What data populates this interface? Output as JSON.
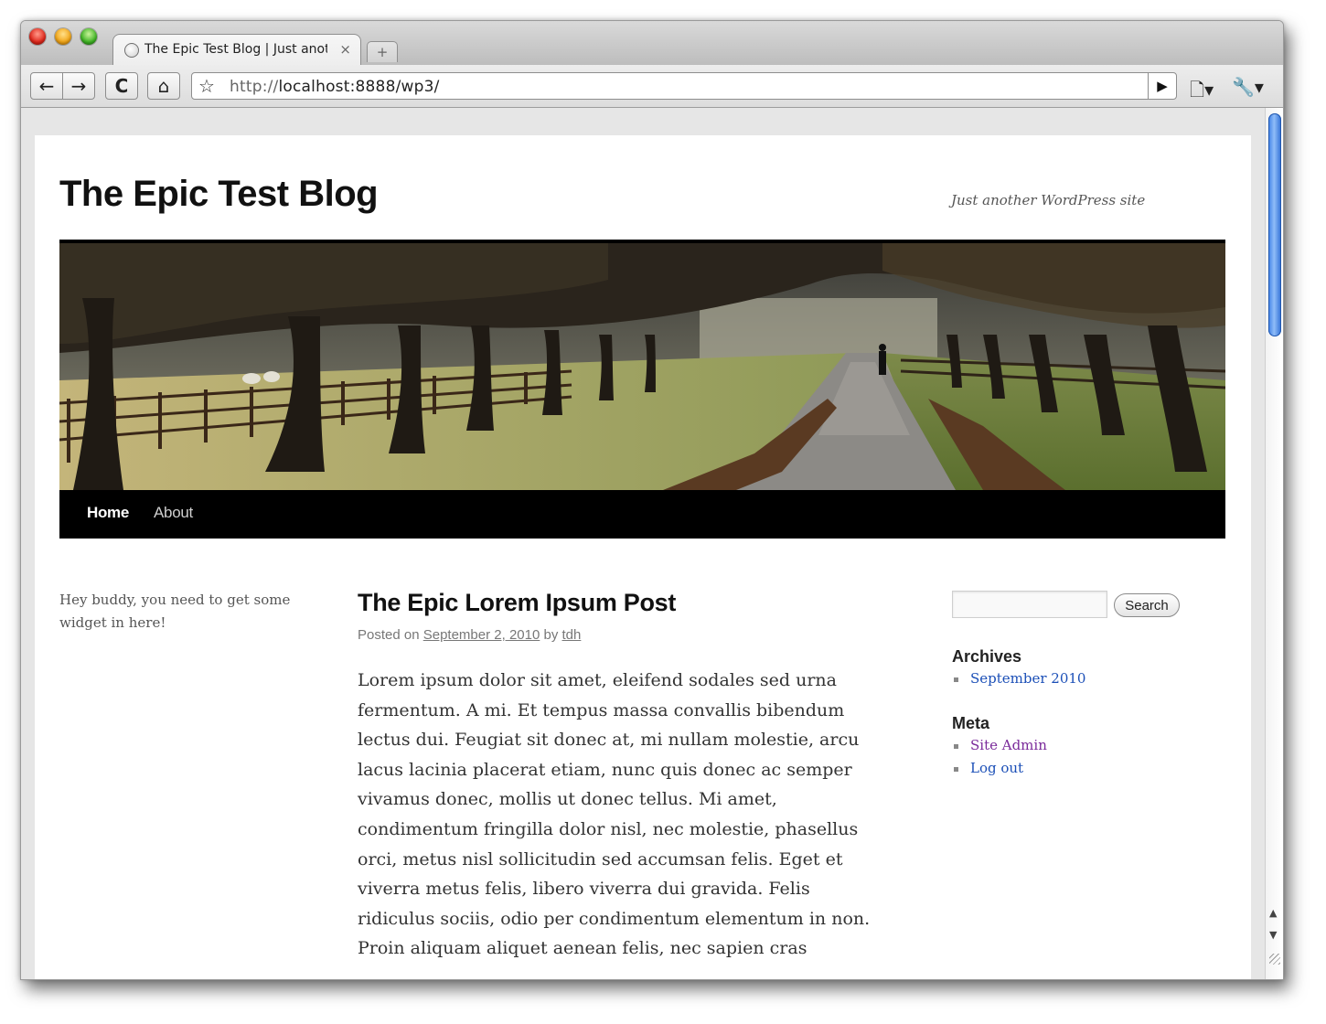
{
  "browser": {
    "tab_title": "The Epic Test Blog | Just another WordPress site",
    "tab_close": "×",
    "new_tab": "+",
    "url_scheme": "http://",
    "url_rest": "localhost:8888/wp3/",
    "back": "←",
    "forward": "→",
    "reload": "C",
    "home": "⌂",
    "bookmark": "☆",
    "go": "▶",
    "page_menu": "🗋▾",
    "tools_menu": "🔧▾"
  },
  "site": {
    "title": "The Epic Test Blog",
    "description": "Just another WordPress site",
    "nav": [
      {
        "label": "Home"
      },
      {
        "label": "About"
      }
    ]
  },
  "left_sidebar": {
    "text": "Hey buddy, you need to get some widget in here!"
  },
  "post": {
    "title": "The Epic Lorem Ipsum Post",
    "meta_prefix": "Posted on",
    "date": "September 2, 2010",
    "meta_by": "by",
    "author": "tdh",
    "body": "Lorem ipsum dolor sit amet, eleifend sodales sed urna fermentum. A mi. Et tempus massa convallis bibendum lectus dui. Feugiat sit donec at, mi nullam molestie, arcu lacus lacinia placerat etiam, nunc quis donec ac semper vivamus donec, mollis ut donec tellus. Mi amet, condimentum fringilla dolor nisl, nec molestie, phasellus orci, metus nisl sollicitudin sed accumsan felis. Eget et viverra metus felis, libero viverra dui gravida. Felis ridiculus sociis, odio per condimentum elementum in non. Proin aliquam aliquet aenean felis, nec sapien cras"
  },
  "right_sidebar": {
    "search_label": "Search",
    "archives_title": "Archives",
    "archives": [
      "September 2010"
    ],
    "meta_title": "Meta",
    "meta_links": [
      "Site Admin",
      "Log out"
    ]
  },
  "colors": {
    "link": "#1b4fb7",
    "visited": "#7a2a9a"
  }
}
